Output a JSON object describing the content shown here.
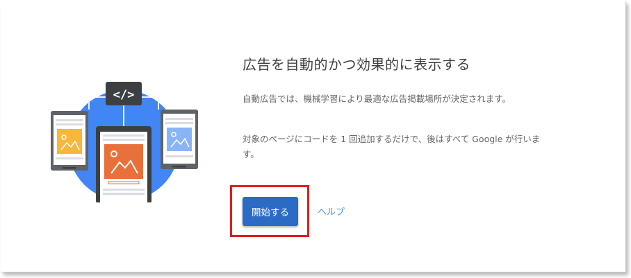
{
  "headline": "広告を自動的かつ効果的に表示する",
  "description_1": "自動広告では、機械学習により最適な広告掲載場所が決定されます。",
  "description_2": "対象のページにコードを 1 回追加するだけで、後はすべて Google が行います。",
  "actions": {
    "start_label": "開始する",
    "help_label": "ヘルプ"
  },
  "illustration": {
    "code_tag": "</>",
    "colors": {
      "circle": "#4285f4",
      "panel_dark": "#3c4043",
      "ad_orange": "#e8703a",
      "ad_yellow": "#f6b73c",
      "ad_blue": "#8ab4f8",
      "highlight_border": "#e21d1d",
      "button": "#2b6bc6",
      "link": "#4a8ce0"
    }
  }
}
